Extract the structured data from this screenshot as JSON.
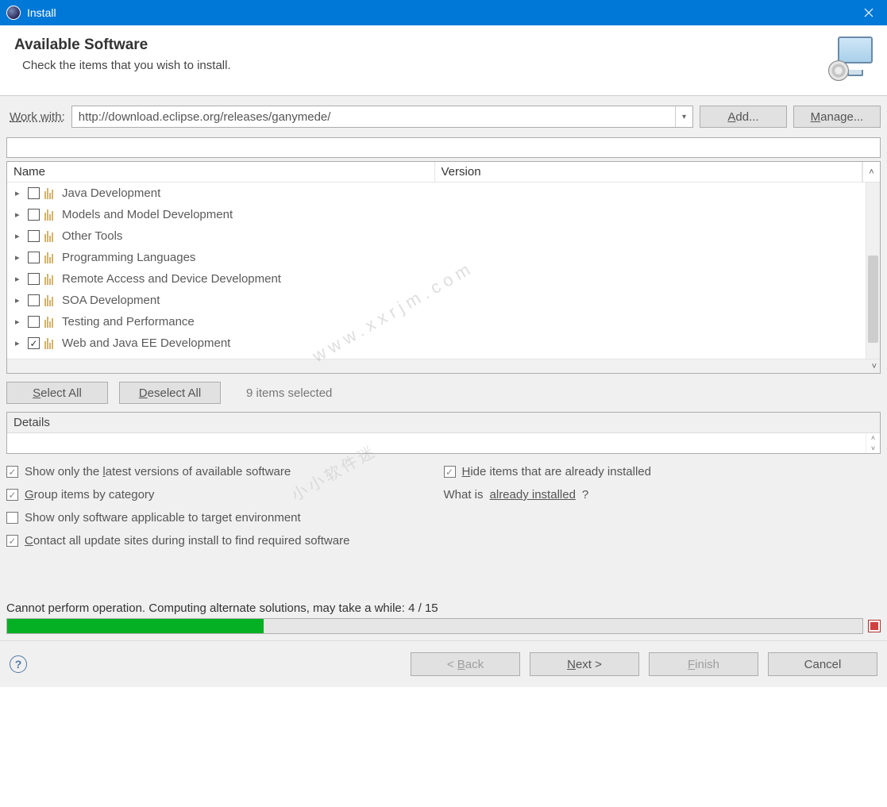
{
  "window": {
    "title": "Install"
  },
  "header": {
    "title": "Available Software",
    "subtitle": "Check the items that you wish to install."
  },
  "work_with": {
    "label": "Work with:",
    "value": "http://download.eclipse.org/releases/ganymede/",
    "add_btn": "Add...",
    "manage_btn": "Manage..."
  },
  "tree": {
    "columns": {
      "name": "Name",
      "version": "Version"
    },
    "items": [
      {
        "label": "Java Development",
        "checked": false
      },
      {
        "label": "Models and Model Development",
        "checked": false
      },
      {
        "label": "Other Tools",
        "checked": false
      },
      {
        "label": "Programming Languages",
        "checked": false
      },
      {
        "label": "Remote Access and Device Development",
        "checked": false
      },
      {
        "label": "SOA Development",
        "checked": false
      },
      {
        "label": "Testing and Performance",
        "checked": false
      },
      {
        "label": "Web and Java EE Development",
        "checked": true
      }
    ]
  },
  "select": {
    "select_all": "Select All",
    "deselect_all": "Deselect All",
    "count_text": "9 items selected"
  },
  "details": {
    "label": "Details"
  },
  "options": {
    "latest": "Show only the latest versions of available software",
    "hide": "Hide items that are already installed",
    "group": "Group items by category",
    "what_is": "What is ",
    "already_installed": "already installed",
    "qmark": "?",
    "applicable": "Show only software applicable to target environment",
    "contact": "Contact all update sites during install to find required software"
  },
  "status": {
    "text": "Cannot perform operation. Computing alternate solutions, may take a while: 4 / 15",
    "progress_percent": 30
  },
  "buttons": {
    "back": "< Back",
    "next": "Next >",
    "finish": "Finish",
    "cancel": "Cancel"
  },
  "watermark": {
    "url": "www.xxrjm.com",
    "text2": "小小软件迷"
  }
}
